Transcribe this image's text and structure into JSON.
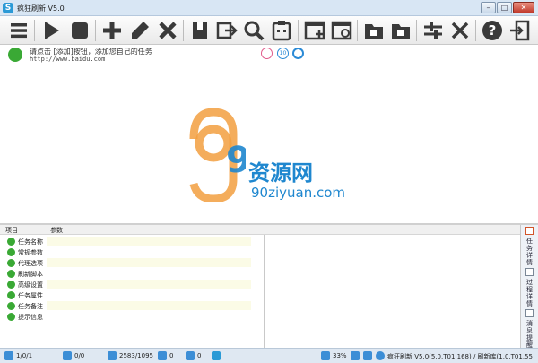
{
  "window": {
    "title": "疯狂刷新 V5.0",
    "buttons": {
      "minimize": "–",
      "maximize": "□",
      "close": "✕"
    }
  },
  "toolbar": {
    "buttons": [
      {
        "name": "menu-button",
        "icon": "menu-icon"
      },
      {
        "name": "start-button",
        "icon": "play-icon"
      },
      {
        "name": "stop-button",
        "icon": "stop-icon"
      },
      {
        "name": "add-task-button",
        "icon": "plus-icon"
      },
      {
        "name": "edit-task-button",
        "icon": "pencil-icon"
      },
      {
        "name": "delete-task-button",
        "icon": "x-icon"
      },
      {
        "name": "bookmark-button",
        "icon": "bookmark-icon"
      },
      {
        "name": "import-button",
        "icon": "import-icon"
      },
      {
        "name": "search-button",
        "icon": "search-icon"
      },
      {
        "name": "clipboard-button",
        "icon": "clipboard-icon"
      },
      {
        "name": "new-window-button",
        "icon": "window-plus-icon"
      },
      {
        "name": "ie-window-button",
        "icon": "ie-icon"
      },
      {
        "name": "folder-open-button",
        "icon": "folder-icon"
      },
      {
        "name": "folder-export-button",
        "icon": "folder-export-icon"
      },
      {
        "name": "adjust-button",
        "icon": "sliders-icon"
      },
      {
        "name": "tools-button",
        "icon": "tools-icon"
      },
      {
        "name": "help-button",
        "icon": "help-icon"
      },
      {
        "name": "exit-button",
        "icon": "exit-icon"
      }
    ]
  },
  "task": {
    "name": "请点击 [添加]按钮，添加您自己的任务",
    "url": "http://www.baidu.com",
    "badges": [
      "",
      "10",
      ""
    ]
  },
  "watermark": {
    "cn": "资源网",
    "en": "90ziyuan.com",
    "mark": "90"
  },
  "properties": {
    "headers": [
      "项目",
      "参数"
    ],
    "rows": [
      "任务名称",
      "常规参数",
      "代理选项",
      "刷新脚本",
      "高级设置",
      "任务属性",
      "任务备注",
      "提示信息"
    ]
  },
  "side_tabs": [
    "任务详情",
    "过程详情",
    "消息提醒"
  ],
  "status": {
    "items": [
      "1/0/1",
      "0/0",
      "2583/1095",
      "0",
      "0",
      "",
      "33%",
      "疯狂刷新 V5.0(5.0.T01.168) / 刷新库(1.0.T01.55"
    ]
  },
  "colors": {
    "accent": "#1f87cf",
    "toolbar_icon": "#3a3a3a",
    "green": "#3aa935",
    "row_alt": "#fbfbe6"
  }
}
